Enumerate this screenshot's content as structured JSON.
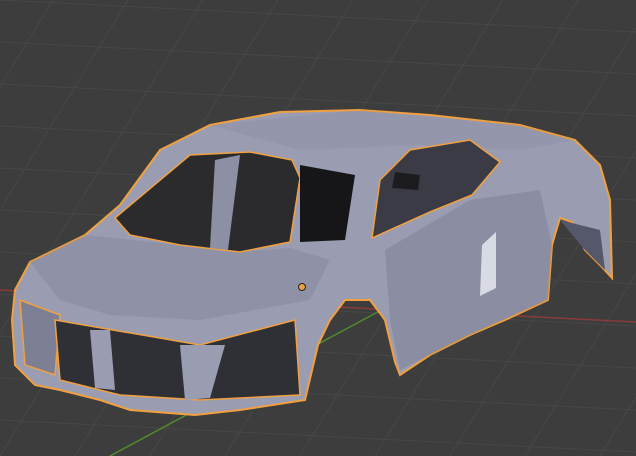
{
  "viewport": {
    "background_color": "#3d3d3d",
    "grid_color": "#474747",
    "x_axis_color": "#8a3a3a",
    "y_axis_color": "#4f8a2e",
    "mesh_color": "#9a9db2",
    "mesh_shadow_color": "#6f7386",
    "selection_outline_color": "#f0a040",
    "origin_color": "#f0a040"
  }
}
